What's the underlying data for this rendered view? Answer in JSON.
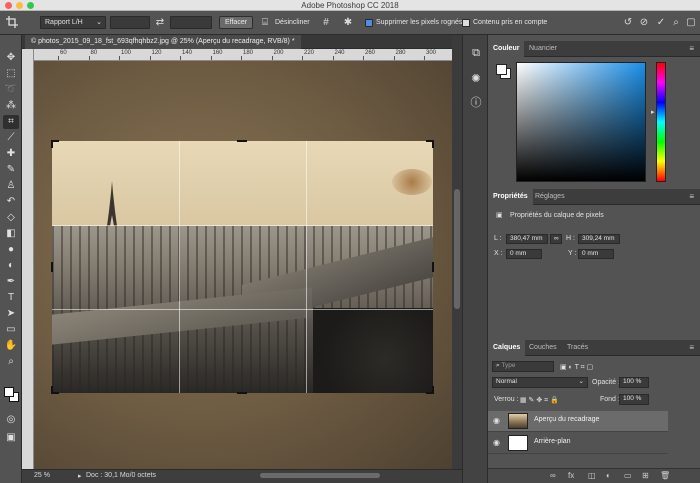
{
  "window": {
    "title": "Adobe Photoshop CC 2018"
  },
  "options_bar": {
    "ratio_select": "Rapport L/H",
    "clear_button": "Effacer",
    "straighten_label": "Désincliner",
    "delete_pixels_label": "Supprimer les pixels rognés",
    "delete_pixels_checked": true,
    "content_aware_label": "Contenu pris en compte",
    "content_aware_checked": false
  },
  "document": {
    "tab_title": "© photos_2015_09_18_fst_693qfhqhbz2.jpg @ 25% (Aperçu du recadrage, RVB/8) *",
    "zoom": "25 %",
    "doc_info": "Doc : 30,1 Mo/0 octets"
  },
  "ruler": {
    "labels": [
      "60",
      "80",
      "100",
      "120",
      "140",
      "160",
      "180",
      "200",
      "220",
      "240",
      "260",
      "280",
      "300"
    ]
  },
  "color_panel": {
    "tabs": [
      "Couleur",
      "Nuancier"
    ]
  },
  "properties_panel": {
    "tabs": [
      "Propriétés",
      "Réglages"
    ],
    "heading": "Propriétés du calque de pixels",
    "l_label": "L :",
    "l_value": "380,47 mm",
    "h_label": "H :",
    "h_value": "309,24 mm",
    "x_label": "X :",
    "x_value": "0 mm",
    "y_label": "Y :",
    "y_value": "0 mm"
  },
  "layers_panel": {
    "tabs": [
      "Calques",
      "Couches",
      "Tracés"
    ],
    "filter_placeholder": "Type",
    "blend_mode": "Normal",
    "opacity_label": "Opacité :",
    "opacity_value": "100 %",
    "lock_label": "Verrou :",
    "fill_label": "Fond :",
    "fill_value": "100 %",
    "layers": [
      {
        "name": "Aperçu du recadrage",
        "selected": true
      },
      {
        "name": "Arrière-plan",
        "selected": false
      }
    ]
  },
  "icons": {
    "toolbar": [
      "move-icon",
      "marquee-icon",
      "lasso-icon",
      "magic-wand-icon",
      "crop-icon",
      "eyedropper-icon",
      "healing-brush-icon",
      "brush-icon",
      "clone-stamp-icon",
      "history-brush-icon",
      "eraser-icon",
      "gradient-icon",
      "blur-icon",
      "dodge-icon",
      "pen-icon",
      "type-icon",
      "path-selection-icon",
      "rectangle-icon",
      "hand-icon",
      "zoom-icon"
    ]
  }
}
